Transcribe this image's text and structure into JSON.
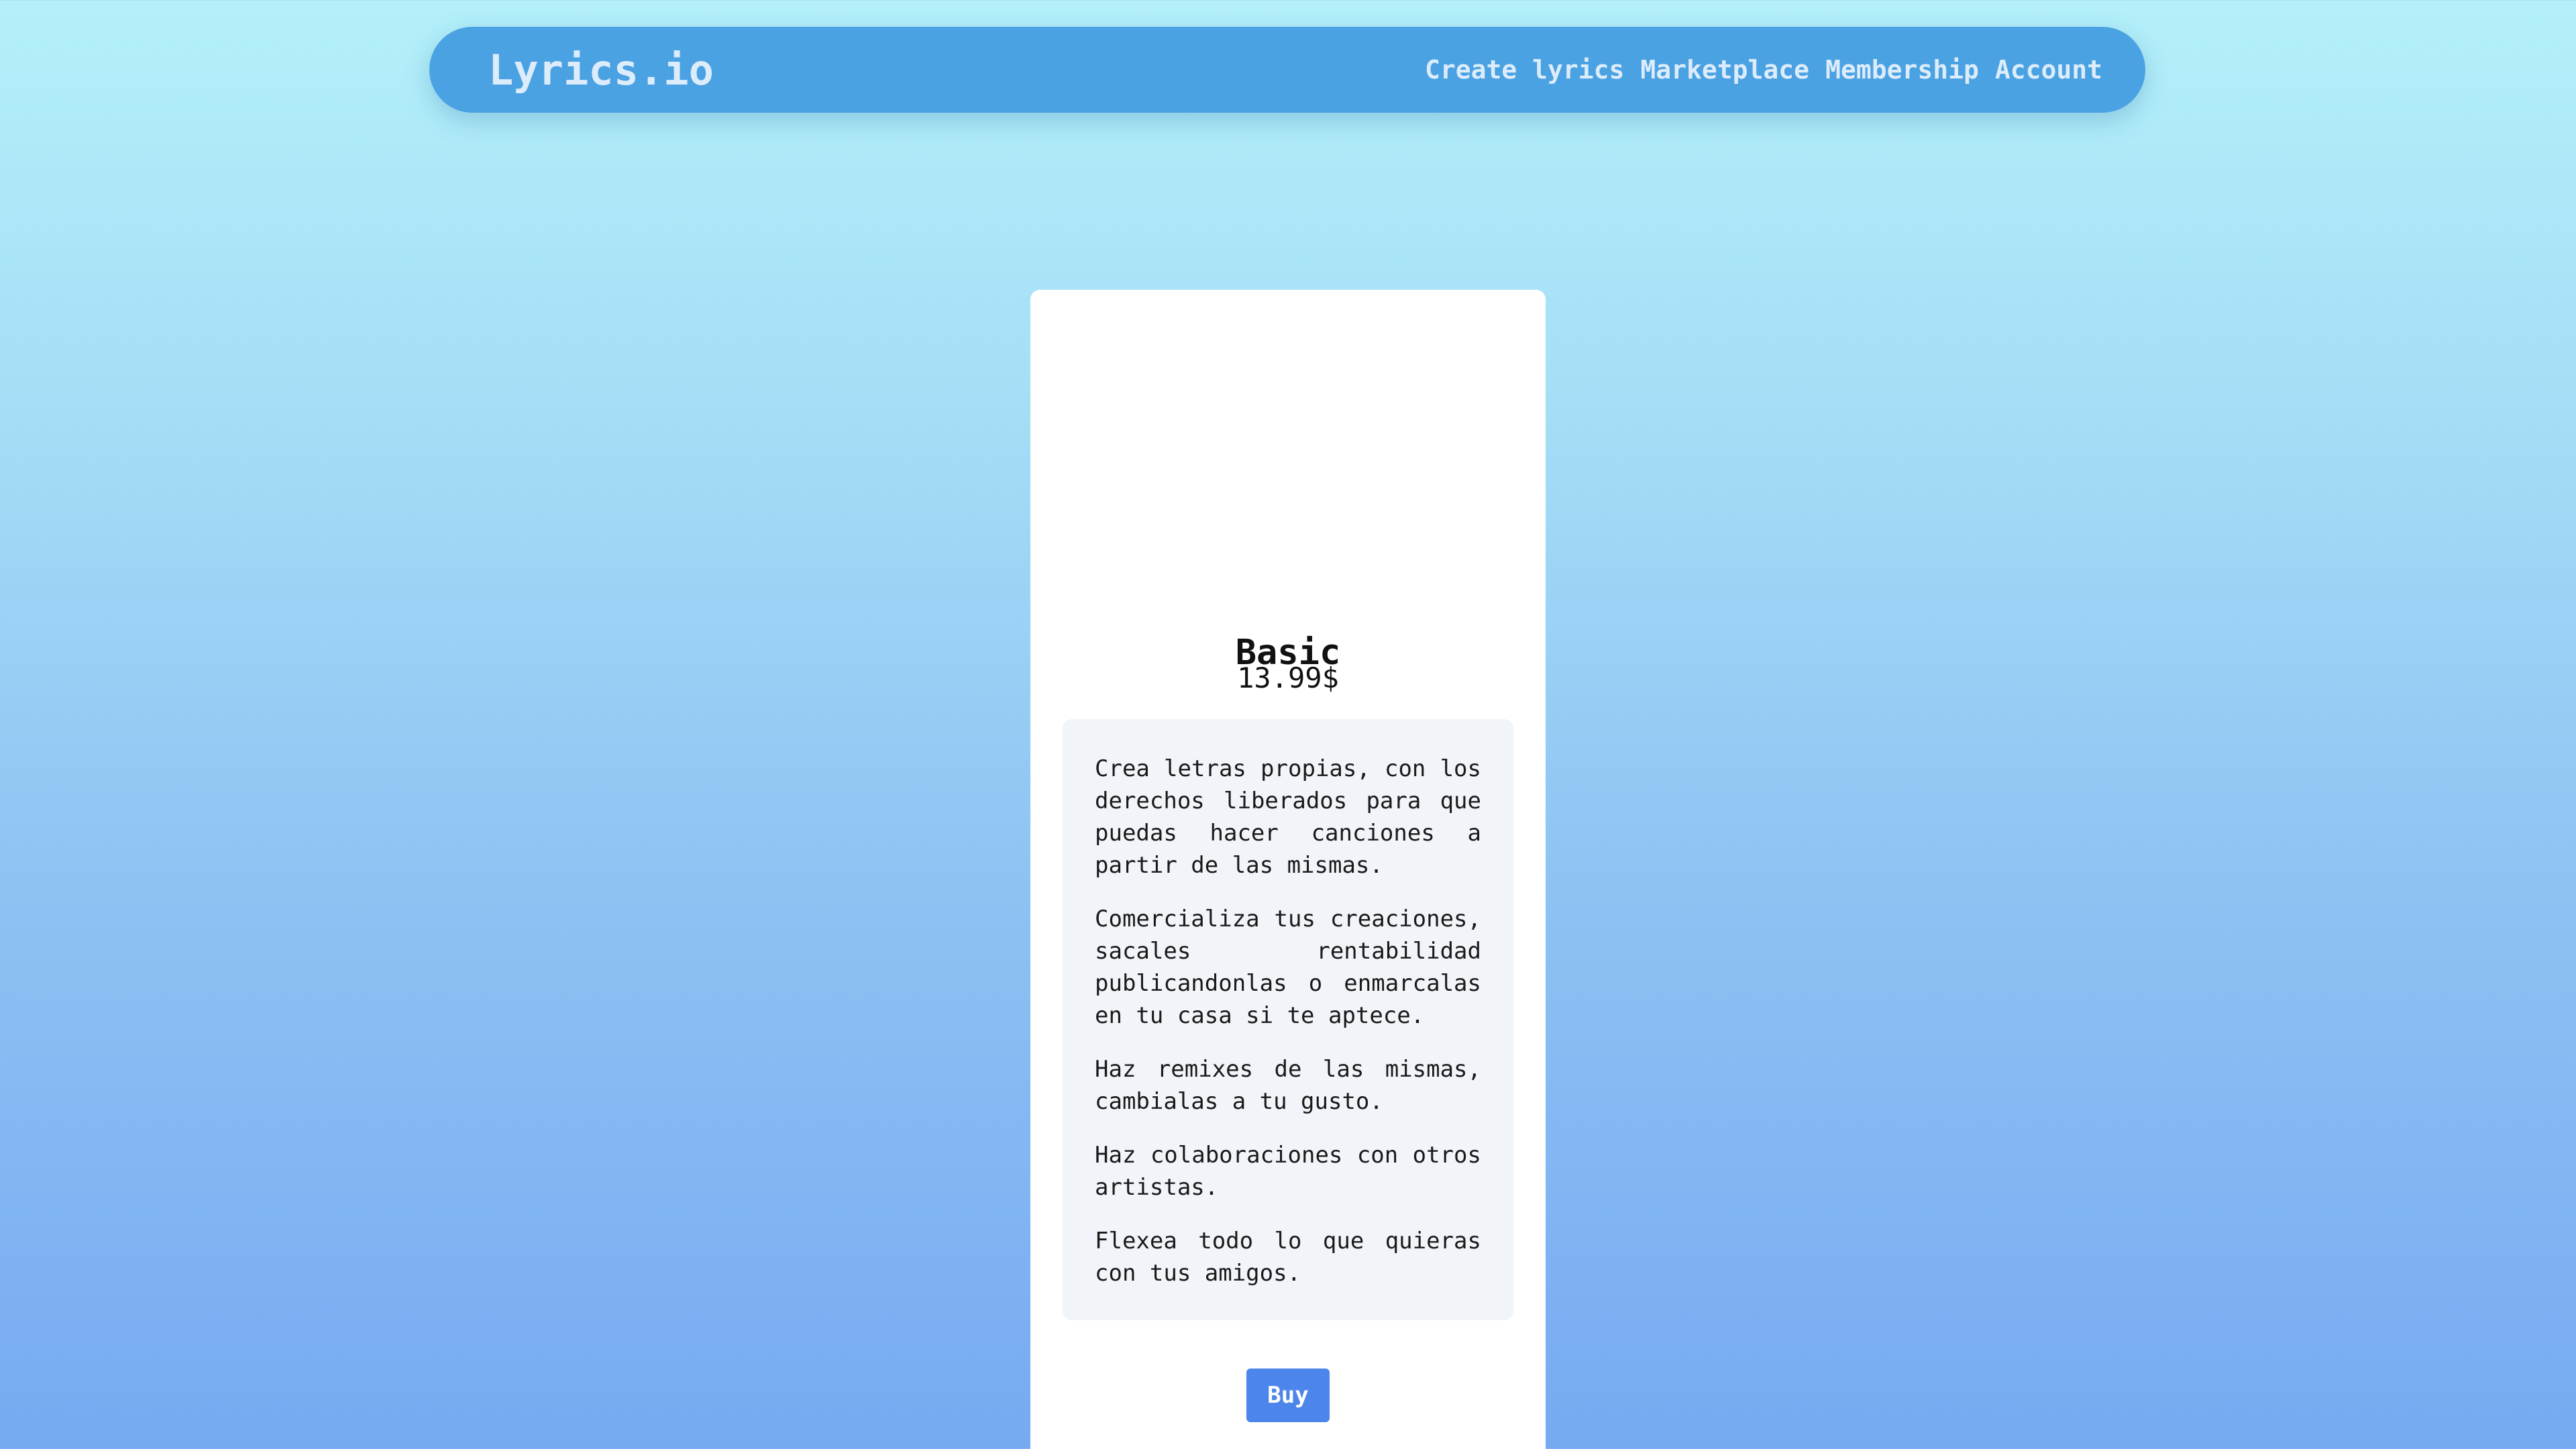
{
  "header": {
    "brand": "Lyrics.io",
    "nav": [
      {
        "label": "Create lyrics"
      },
      {
        "label": "Marketplace"
      },
      {
        "label": "Membership"
      },
      {
        "label": "Account"
      }
    ]
  },
  "plan": {
    "title": "Basic",
    "price": "13.99$",
    "features": [
      "Crea letras propias, con los derechos liberados para que puedas hacer canciones a partir de las mismas.",
      "Comercializa tus creaciones, sacales rentabilidad publicandonlas o enmarcalas en tu casa si te aptece.",
      "Haz remixes de las mismas, cambialas a tu gusto.",
      "Haz colaboraciones con otros artistas.",
      "Flexea todo lo que quieras con tus amigos."
    ],
    "buy_label": "Buy"
  },
  "colors": {
    "navbar": "#4aa2e3",
    "button": "#4d86ea",
    "background_top": "#b4f0f9",
    "background_bottom": "#77a9f1"
  }
}
